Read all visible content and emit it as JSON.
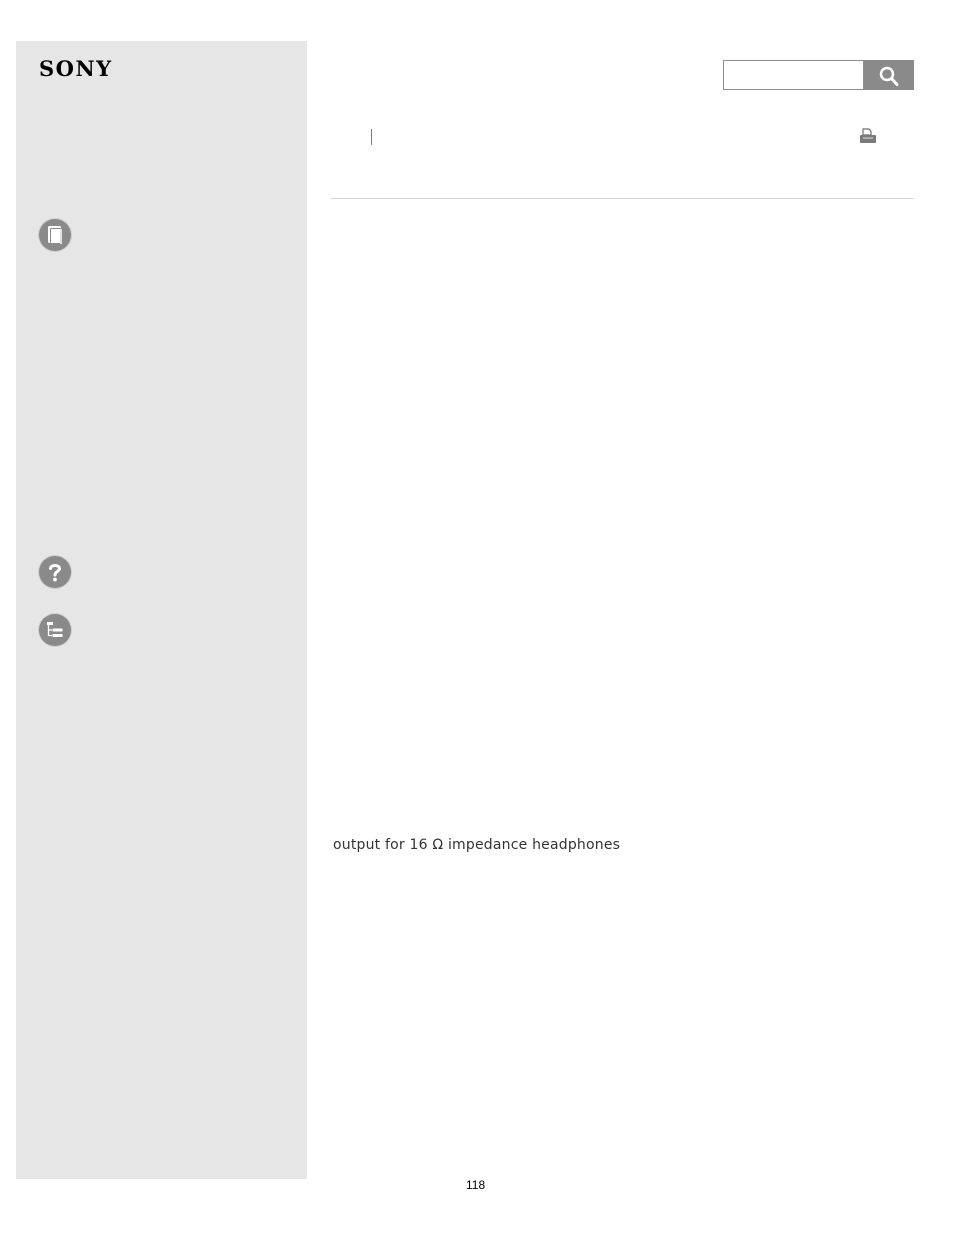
{
  "header": {
    "logo_text": "SONY",
    "search": {
      "value": "",
      "placeholder": ""
    }
  },
  "sidebar": {
    "icons": [
      "book-icon",
      "help-icon",
      "table-of-contents-icon"
    ]
  },
  "toolbar": {
    "print_icon": "print-icon"
  },
  "content": {
    "text": "output for 16 Ω impedance headphones"
  },
  "footer": {
    "page_number": "118"
  },
  "colors": {
    "sidebar_bg": "#e6e6e6",
    "icon_gray": "#8a8a8a",
    "search_button": "#8a8a8a"
  }
}
